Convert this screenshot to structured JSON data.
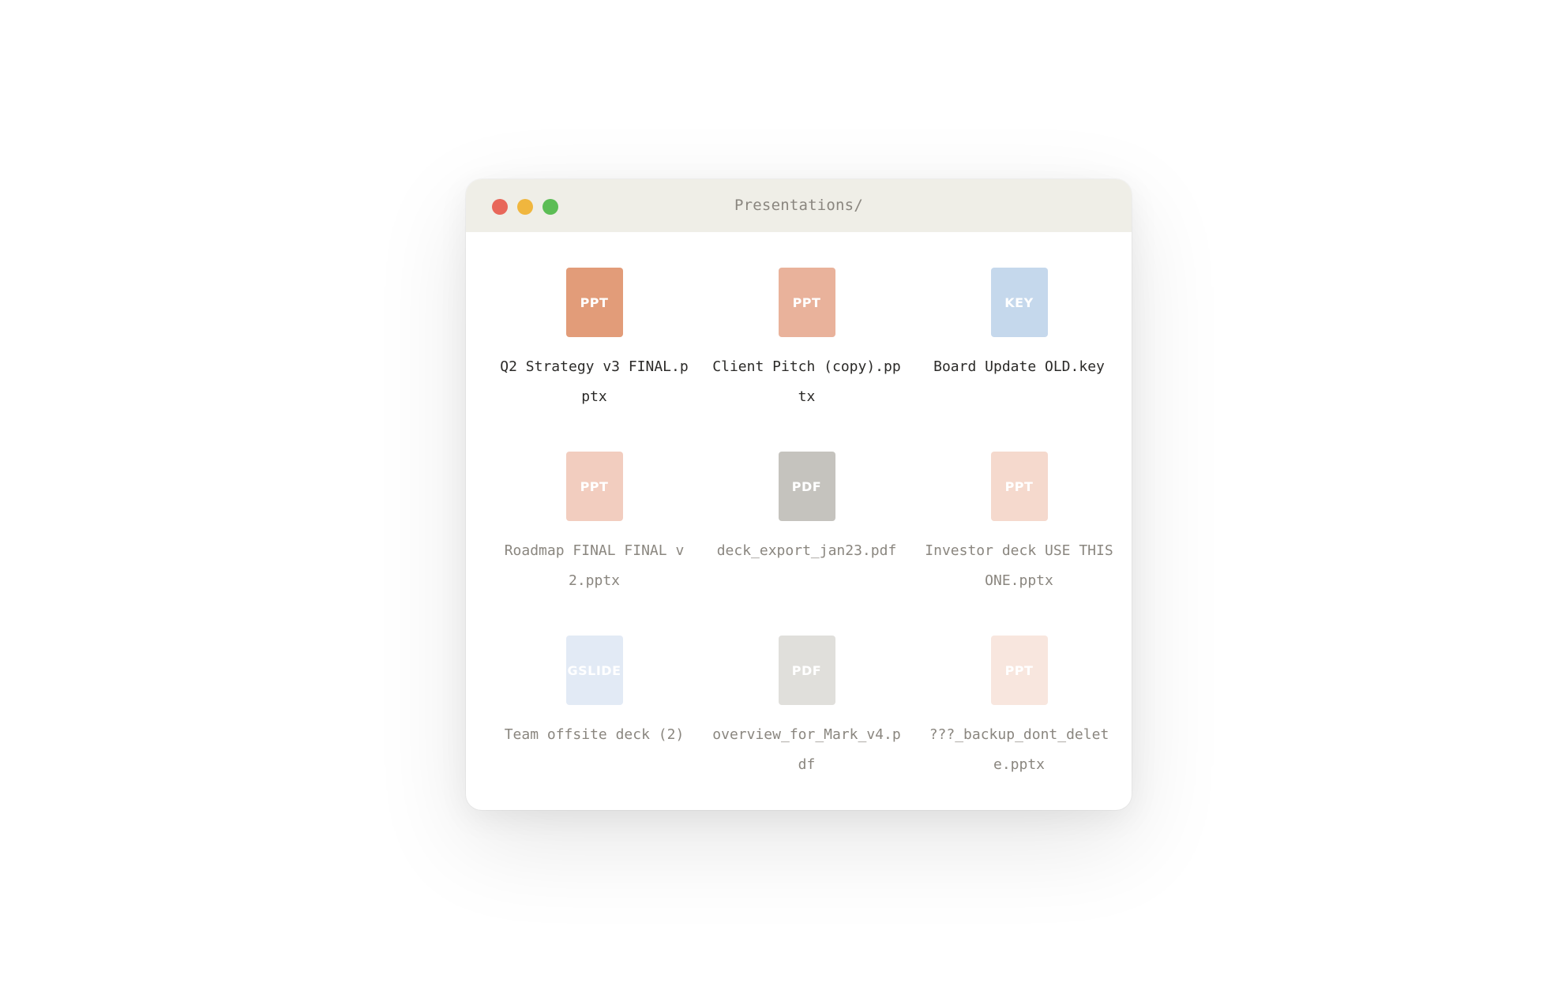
{
  "window": {
    "title": "Presentations/",
    "traffic_lights": {
      "close": "#e8675a",
      "minimize": "#f0b63e",
      "maximize": "#5cbd55"
    }
  },
  "files": [
    {
      "name": "Q2 Strategy v3 FINAL.pptx",
      "type": "PPT",
      "icon_color": "#e29c79",
      "text_color": "#2b2a28"
    },
    {
      "name": "Client Pitch (copy).pptx",
      "type": "PPT",
      "icon_color": "#e9b29b",
      "text_color": "#2b2a28"
    },
    {
      "name": "Board Update OLD.key",
      "type": "KEY",
      "icon_color": "#c5d8ec",
      "text_color": "#2b2a28"
    },
    {
      "name": "Roadmap FINAL FINAL v2.pptx",
      "type": "PPT",
      "icon_color": "#f2cdbf",
      "text_color": "#8a867f"
    },
    {
      "name": "deck_export_jan23.pdf",
      "type": "PDF",
      "icon_color": "#c5c3be",
      "text_color": "#8a867f"
    },
    {
      "name": "Investor deck USE THIS ONE.pptx",
      "type": "PPT",
      "icon_color": "#f5d9cd",
      "text_color": "#8a867f"
    },
    {
      "name": "Team offsite deck (2)",
      "type": "GSLIDE",
      "icon_color": "#e2eaf5",
      "text_color": "#8a867f"
    },
    {
      "name": "overview_for_Mark_v4.pdf",
      "type": "PDF",
      "icon_color": "#e0dfdb",
      "text_color": "#8a867f"
    },
    {
      "name": "???_backup_dont_delete.pptx",
      "type": "PPT",
      "icon_color": "#f8e6de",
      "text_color": "#8a867f"
    }
  ]
}
